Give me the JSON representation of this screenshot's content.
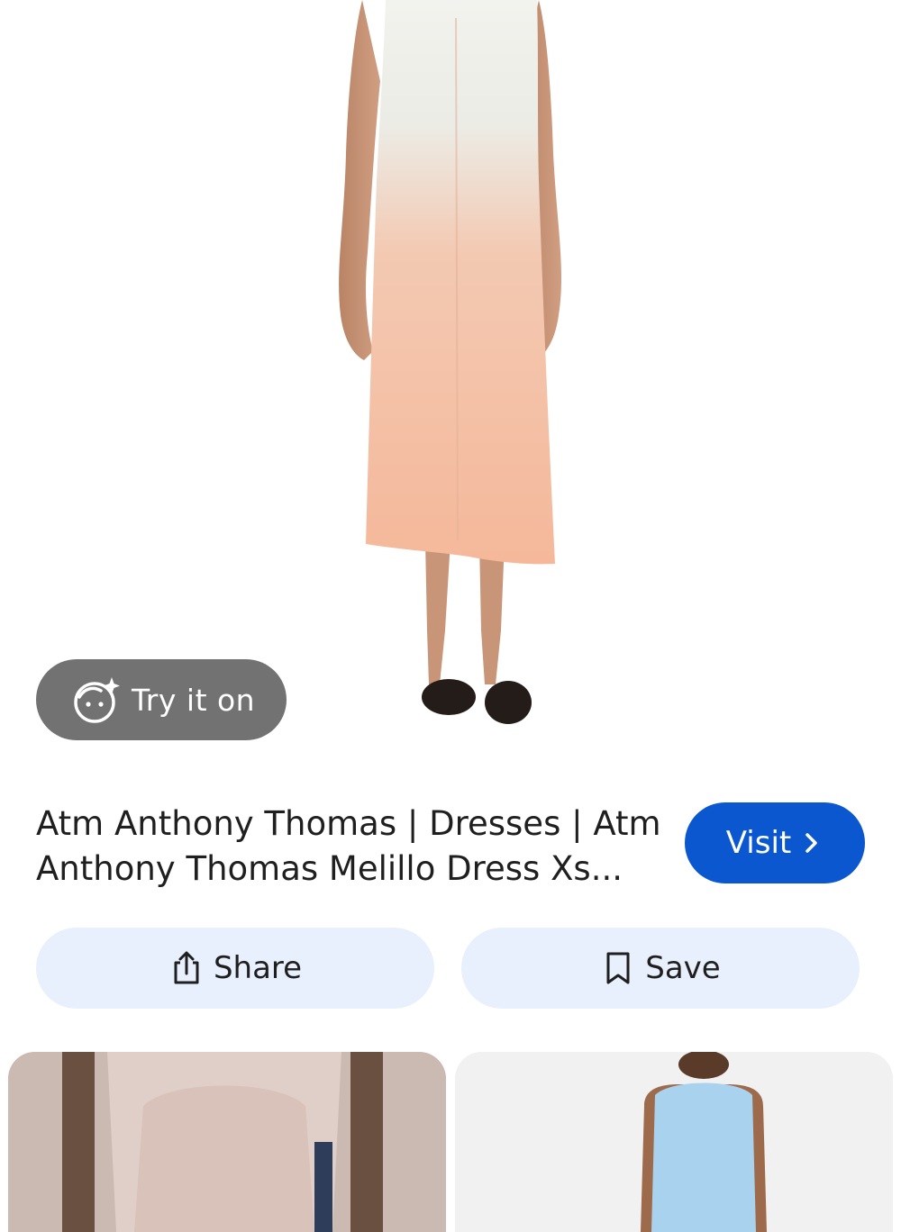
{
  "hero": {
    "image_name": "dress-product-image"
  },
  "try_on": {
    "label": "Try it on",
    "icon": "sparkle-face-icon"
  },
  "result": {
    "title": "Atm Anthony Thomas | Dresses | Atm Anthony Thomas Melillo Dress Xs...",
    "visit_label": "Visit",
    "visit_icon": "chevron-right-icon"
  },
  "actions": {
    "share_label": "Share",
    "share_icon": "share-icon",
    "save_label": "Save",
    "save_icon": "bookmark-icon"
  },
  "colors": {
    "accent": "#0b57d0",
    "chip_bg": "#e8effd",
    "try_on_bg": "#5f5f5f"
  }
}
